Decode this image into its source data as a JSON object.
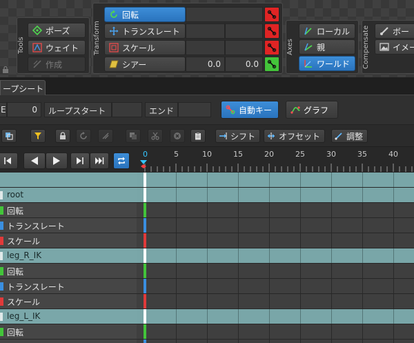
{
  "tools": {
    "group_label": "Tools",
    "pose": "ポーズ",
    "weight": "ウェイト",
    "create": "作成"
  },
  "transform": {
    "group_label": "Transform",
    "rotate": "回転",
    "translate": "トランスレート",
    "scale": "スケール",
    "shear": "シアー",
    "shear_x": "0.0",
    "shear_y": "0.0"
  },
  "axes": {
    "group_label": "Axes",
    "local": "ローカル",
    "parent": "親",
    "world": "ワールド"
  },
  "compensate": {
    "group_label": "Compensate",
    "bone": "ボー",
    "image": "イメー"
  },
  "tabs": {
    "loopsheet": "ープシート"
  },
  "loop": {
    "frame_label": "E",
    "frame_value": "0",
    "loop_start": "ループスタート",
    "end": "エンド",
    "auto_key": "自動キー",
    "graph": "グラフ"
  },
  "toolbar": {
    "shift": "シフト",
    "offset": "オフセット",
    "adjust": "調整"
  },
  "ruler": {
    "ticks": [
      "0",
      "5",
      "10",
      "15",
      "20",
      "25",
      "30",
      "35",
      "40"
    ]
  },
  "rows": [
    {
      "label": "",
      "kind": "group"
    },
    {
      "label": "root",
      "kind": "group"
    },
    {
      "label": "回転",
      "kind": "sub"
    },
    {
      "label": "トランスレート",
      "kind": "sub"
    },
    {
      "label": "スケール",
      "kind": "sub"
    },
    {
      "label": "leg_R_IK",
      "kind": "group"
    },
    {
      "label": "回転",
      "kind": "sub"
    },
    {
      "label": "トランスレート",
      "kind": "sub"
    },
    {
      "label": "スケール",
      "kind": "sub"
    },
    {
      "label": "leg_L_IK",
      "kind": "group"
    },
    {
      "label": "回転",
      "kind": "sub"
    },
    {
      "label": "",
      "kind": "sub"
    }
  ],
  "colors": {
    "accent_blue": "#2a80d2",
    "key_red": "#e02424",
    "key_green": "#43c43a",
    "group_row": "#7aa7a9",
    "playhead": "#35c6ff"
  }
}
